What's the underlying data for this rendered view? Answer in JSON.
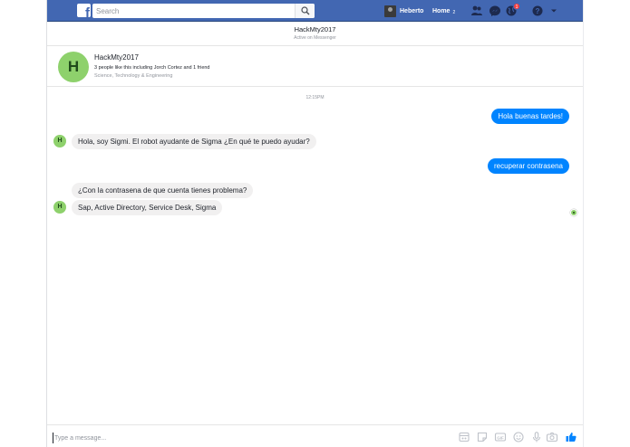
{
  "topbar": {
    "search_placeholder": "Search",
    "user_name": "Heberto",
    "home_label": "Home",
    "home_count": "2",
    "notifications_badge": "1",
    "brand_color": "#4267b2"
  },
  "conversation": {
    "title": "HackMty2017",
    "status": "Active on Messenger"
  },
  "page_card": {
    "avatar_letter": "H",
    "name": "HackMty2017",
    "likes": "3 people like this including Jorch Cortez and 1 friend",
    "category": "Science, Technology & Engineering"
  },
  "timestamp": "12:15PM",
  "messages": [
    {
      "from": "user",
      "text": "Hola buenas tardes!"
    },
    {
      "from": "bot",
      "text": "Hola, soy Sigmi. El robot ayudante de Sigma ¿En qué te puedo ayudar?"
    },
    {
      "from": "user",
      "text": "recuperar contrasena"
    },
    {
      "from": "bot",
      "text": "¿Con la contrasena de que cuenta tienes problema?"
    },
    {
      "from": "bot",
      "text": "Sap, Active Directory, Service Desk, Sigma"
    }
  ],
  "bot_avatar_letter": "H",
  "composer": {
    "placeholder": "Type a message...",
    "tools": [
      "sticker-grid-icon",
      "sticker-icon",
      "gif-icon",
      "emoji-icon",
      "microphone-icon",
      "camera-icon",
      "thumbs-up-icon"
    ]
  },
  "colors": {
    "outgoing_bubble": "#0084ff",
    "incoming_bubble": "#f1f0f0",
    "avatar_green": "#8ed16c"
  }
}
